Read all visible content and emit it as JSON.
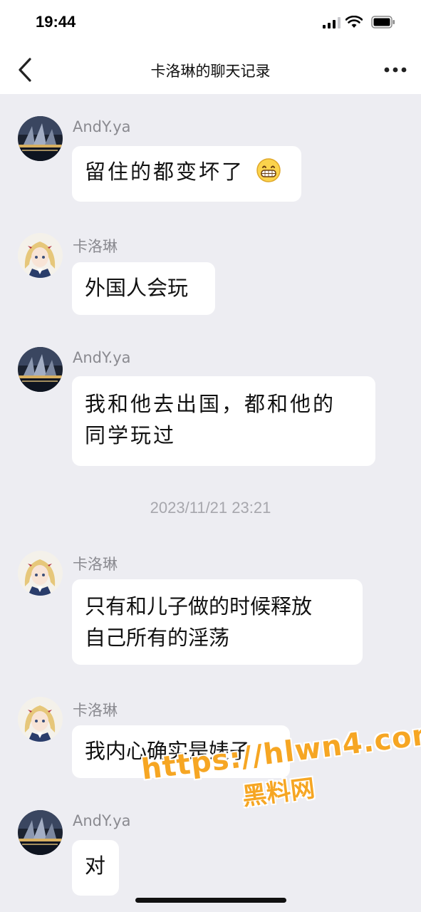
{
  "status_bar": {
    "time": "19:44"
  },
  "nav": {
    "title": "卡洛琳的聊天记录"
  },
  "messages": [
    {
      "sender": "AndY.ya",
      "text": "留住的都变坏了",
      "emoji": "grinning-face-emoji"
    },
    {
      "sender": "卡洛琳",
      "text": "外国人会玩"
    },
    {
      "sender": "AndY.ya",
      "line1": "我和他去出国，都和他的",
      "line2": "同学玩过"
    },
    {
      "sender": "卡洛琳",
      "line1": "只有和儿子做的时候释放",
      "line2": "自己所有的淫荡"
    },
    {
      "sender": "卡洛琳",
      "text": "我内心确实是婊子"
    },
    {
      "sender": "AndY.ya",
      "text": "对"
    }
  ],
  "timestamp": "2023/11/21 23:21",
  "watermark": {
    "url": "https://hlwn4.com",
    "name": "黑料网"
  },
  "colors": {
    "background": "#ededf2",
    "bubble": "#ffffff",
    "watermark": "#f6a623"
  }
}
